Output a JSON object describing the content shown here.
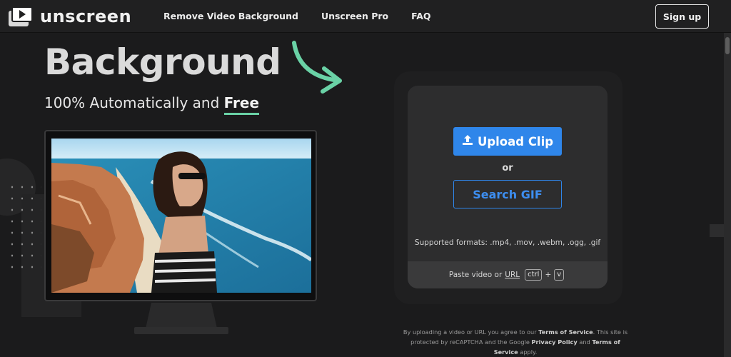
{
  "header": {
    "brand": "unscreen",
    "nav": [
      "Remove Video Background",
      "Unscreen Pro",
      "FAQ"
    ],
    "signup_label": "Sign up"
  },
  "hero": {
    "title": "Background",
    "subtitle_prefix": "100% Automatically and ",
    "subtitle_emphasis": "Free"
  },
  "upload": {
    "upload_label": "Upload Clip",
    "or_label": "or",
    "search_gif_label": "Search GIF",
    "formats": "Supported formats: .mp4, .mov, .webm, .ogg, .gif",
    "paste_prefix": "Paste video or",
    "paste_url": "URL",
    "key_ctrl": "ctrl",
    "key_plus": "+",
    "key_v": "v"
  },
  "terms": {
    "t1": "By uploading a video or URL you agree to our ",
    "tos": "Terms of Service",
    "t2": ". This site is protected by reCAPTCHA and the Google ",
    "privacy": "Privacy Policy",
    "t3": " and ",
    "tos2": "Terms of Service",
    "t4": " apply."
  },
  "colors": {
    "accent": "#2f86ea",
    "highlight": "#6ad2a6",
    "background": "#1b1b1c"
  },
  "icons": [
    "play-logo-icon",
    "arrow-curve-icon",
    "upload-icon"
  ]
}
